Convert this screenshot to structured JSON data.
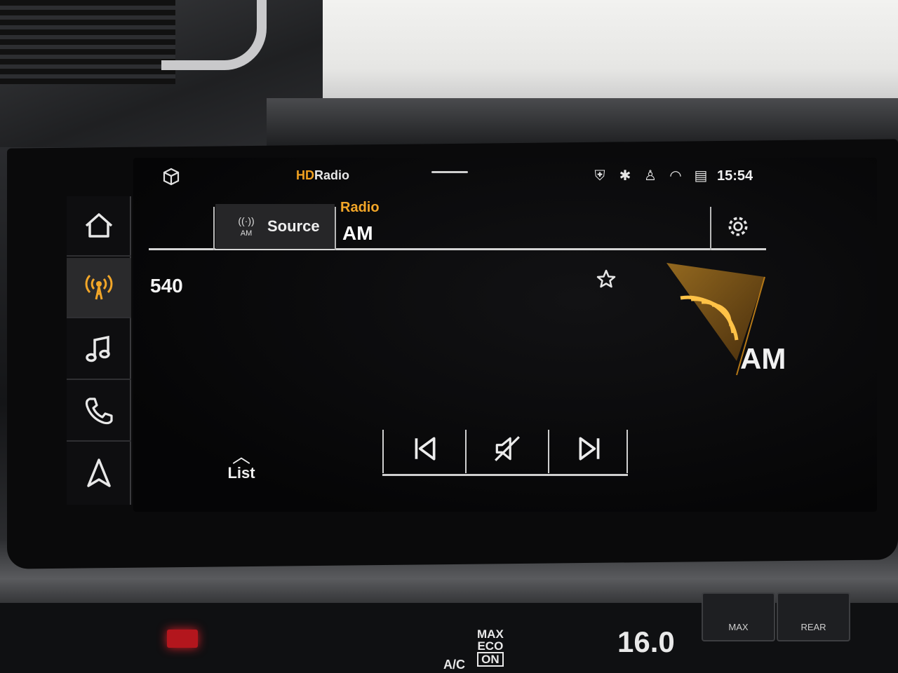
{
  "status_bar": {
    "brand_mark": "HD",
    "brand_word": "Radio",
    "clock": "15:54"
  },
  "header": {
    "source_band_badge": "AM",
    "source_label": "Source",
    "section_label": "Radio",
    "band_label": "AM"
  },
  "station": {
    "frequency": "540"
  },
  "artwork": {
    "label": "AM"
  },
  "list_button": {
    "label": "List"
  },
  "climate": {
    "temp_right": "16.0",
    "max_eco_line1": "MAX",
    "max_eco_line2": "ECO",
    "max_eco_line3": "ON",
    "ac_label": "A/C",
    "defrost_max_label": "MAX",
    "defrost_rear_label": "REAR"
  },
  "colors": {
    "accent": "#f2a628",
    "text": "#f0f0f0",
    "screen_bg": "#060607"
  }
}
